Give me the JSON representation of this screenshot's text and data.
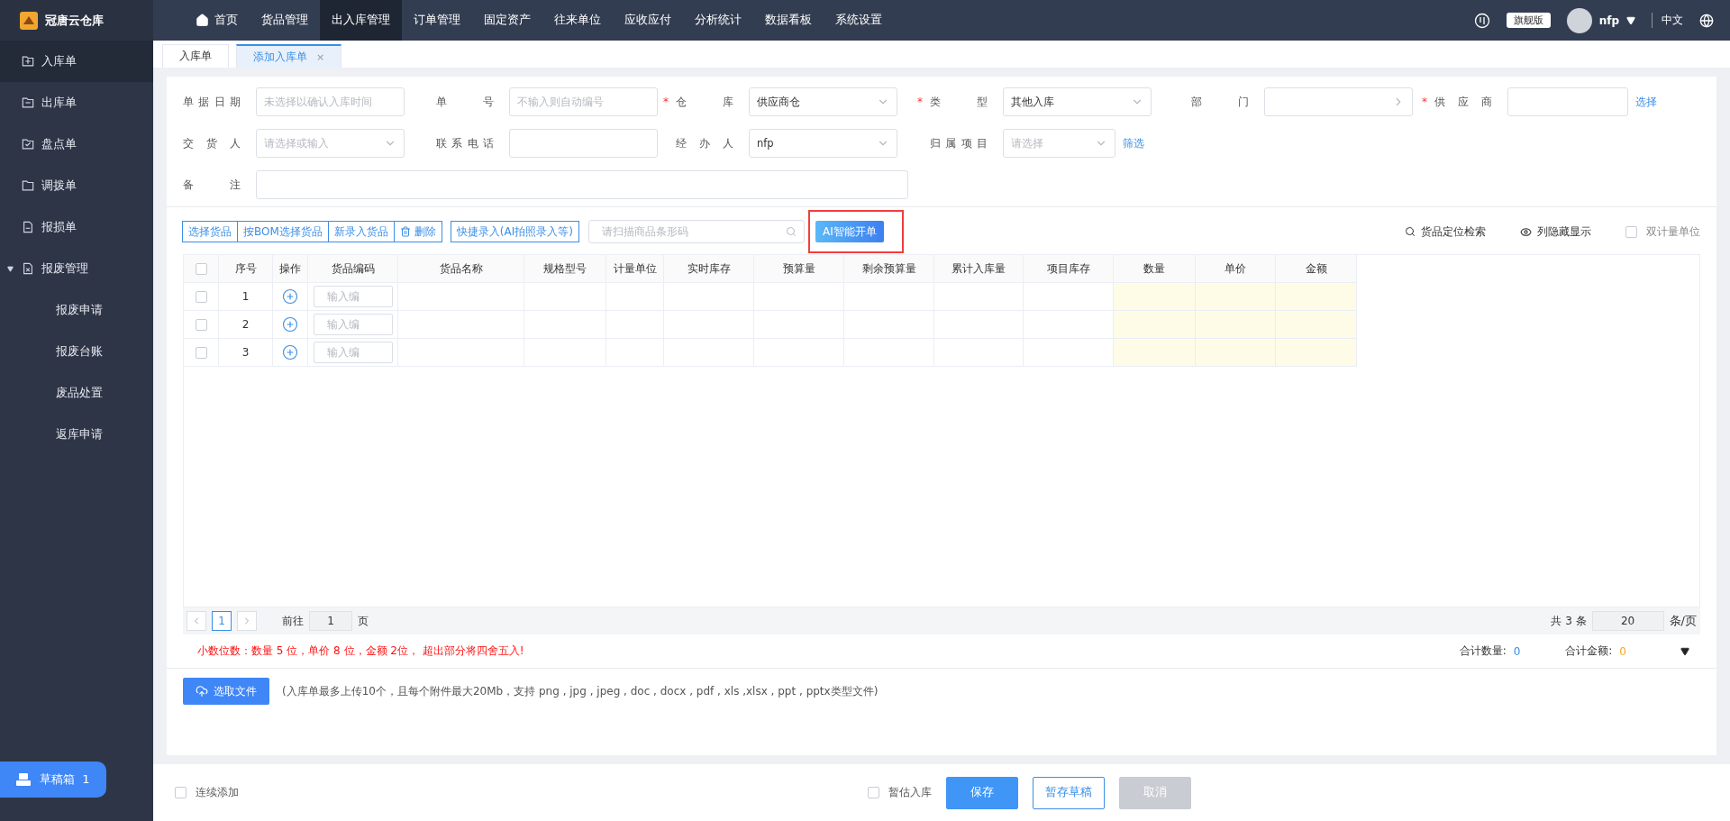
{
  "app": {
    "name": "冠唐云仓库"
  },
  "nav": [
    {
      "label": "首页",
      "selected": false
    },
    {
      "label": "货品管理",
      "selected": false
    },
    {
      "label": "出入库管理",
      "selected": true
    },
    {
      "label": "订单管理",
      "selected": false
    },
    {
      "label": "固定资产",
      "selected": false
    },
    {
      "label": "往来单位",
      "selected": false
    },
    {
      "label": "应收应付",
      "selected": false
    },
    {
      "label": "分析统计",
      "selected": false
    },
    {
      "label": "数据看板",
      "selected": false
    },
    {
      "label": "系统设置",
      "selected": false
    }
  ],
  "header": {
    "edition": "旗舰版",
    "user": "nfp",
    "language": "中文"
  },
  "sidebar": [
    {
      "label": "入库单",
      "selected": true
    },
    {
      "label": "出库单",
      "selected": false
    },
    {
      "label": "盘点单",
      "selected": false
    },
    {
      "label": "调拨单",
      "selected": false
    },
    {
      "label": "报损单",
      "selected": false
    },
    {
      "label": "报废管理",
      "selected": false,
      "expanded": true,
      "children": [
        {
          "label": "报废申请",
          "selected": false
        },
        {
          "label": "报废台账",
          "selected": false
        },
        {
          "label": "废品处置",
          "selected": false
        },
        {
          "label": "返库申请",
          "selected": false
        }
      ]
    }
  ],
  "drafts": {
    "label": "草稿箱",
    "count": "1"
  },
  "tabs": [
    {
      "label": "入库单",
      "selected": false
    },
    {
      "label": "添加入库单",
      "selected": true,
      "close": "×"
    }
  ],
  "form": {
    "rows": [
      [
        {
          "label": "单据日期",
          "kind": "text",
          "placeholder": "未选择以确认入库时间"
        },
        {
          "label": "单号",
          "kind": "text",
          "placeholder": "不输入则自动编号"
        },
        {
          "label": "仓库",
          "required_mark": "*",
          "kind": "select",
          "value": "供应商仓"
        },
        {
          "label": "类型",
          "required_mark": "*",
          "kind": "select",
          "value": "其他入库"
        },
        {
          "label": "部门",
          "kind": "picker"
        },
        {
          "label": "供应商",
          "required_mark": "*",
          "kind": "text",
          "link": "选择"
        }
      ],
      [
        {
          "label": "交货人",
          "kind": "select",
          "placeholder": "请选择或输入"
        },
        {
          "label": "联系电话",
          "kind": "text"
        },
        {
          "label": "经办人",
          "kind": "select",
          "value": "nfp"
        },
        {
          "label": "归属项目",
          "kind": "select",
          "placeholder": "请选择",
          "link": "筛选"
        }
      ],
      [
        {
          "label": "备注",
          "kind": "wide"
        }
      ]
    ]
  },
  "toolbar": {
    "buttons": [
      {
        "label": "选择货品"
      },
      {
        "label": "按BOM选择货品"
      },
      {
        "label": "新录入货品"
      },
      {
        "label": "删除"
      }
    ],
    "quick": "快捷录入(AI拍照录入等)",
    "scan_placeholder": "请扫描商品条形码",
    "ai_button": {
      "label": "AI智能开单",
      "highlighted": true
    },
    "locate": "货品定位检索",
    "columns_toggle": "列隐藏显示",
    "dual_unit": {
      "label": "双计量单位",
      "checked": false
    }
  },
  "table": {
    "all_checked": false,
    "columns": [
      {
        "label": "序号",
        "editable": false
      },
      {
        "label": "操作",
        "editable": false
      },
      {
        "label": "货品编码",
        "editable": false
      },
      {
        "label": "货品名称",
        "editable": false
      },
      {
        "label": "规格型号",
        "editable": false
      },
      {
        "label": "计量单位",
        "editable": false
      },
      {
        "label": "实时库存",
        "editable": false
      },
      {
        "label": "预算量",
        "editable": false
      },
      {
        "label": "剩余预算量",
        "editable": false
      },
      {
        "label": "累计入库量",
        "editable": false
      },
      {
        "label": "项目库存",
        "editable": false
      },
      {
        "label": "数量",
        "editable": true
      },
      {
        "label": "单价",
        "editable": true
      },
      {
        "label": "金额",
        "editable": true
      }
    ],
    "rows": [
      {
        "index": "1",
        "checked": false,
        "code_placeholder": "输入编"
      },
      {
        "index": "2",
        "checked": false,
        "code_placeholder": "输入编"
      },
      {
        "index": "3",
        "checked": false,
        "code_placeholder": "输入编"
      }
    ]
  },
  "pagination": {
    "page": "1",
    "goto_label": "前往",
    "goto_value": "1",
    "page_suffix": "页",
    "total": "共 3 条",
    "page_size": "20",
    "size_suffix": "条/页"
  },
  "summary": {
    "notice": "小数位数：数量 5 位，单价 8 位，金额 2位， 超出部分将四舍五入!",
    "qty_label": "合计数量:",
    "qty": "0",
    "amount_label": "合计金额:",
    "amount": "0"
  },
  "upload": {
    "button": "选取文件",
    "hint": "(入库单最多上传10个，且每个附件最大20Mb，支持 png , jpg , jpeg , doc , docx , pdf , xls ,xlsx , ppt , pptx类型文件)"
  },
  "footer": {
    "continuous": {
      "label": "连续添加",
      "checked": false
    },
    "estimate": {
      "label": "暂估入库",
      "checked": false
    },
    "buttons": [
      {
        "label": "保存",
        "kind": "primary"
      },
      {
        "label": "暂存草稿",
        "kind": "outline"
      },
      {
        "label": "取消",
        "kind": "disabled"
      }
    ]
  }
}
